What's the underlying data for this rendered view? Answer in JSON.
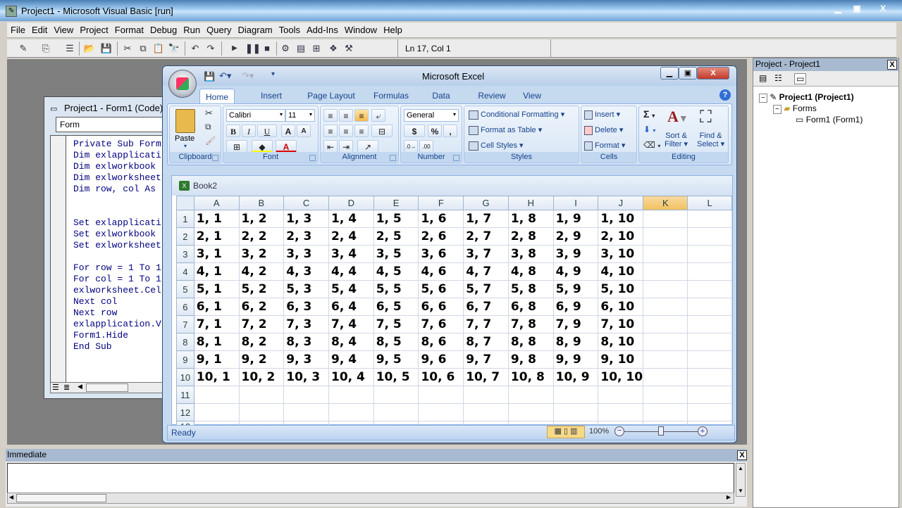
{
  "vb": {
    "title": "Project1 - Microsoft Visual Basic [run]",
    "menu": [
      "File",
      "Edit",
      "View",
      "Project",
      "Format",
      "Debug",
      "Run",
      "Query",
      "Diagram",
      "Tools",
      "Add-Ins",
      "Window",
      "Help"
    ],
    "status_position": "Ln 17, Col 1",
    "window_controls": {
      "minimize": "‒",
      "restore": "▫",
      "close": "X"
    }
  },
  "code_window": {
    "title": "Project1 - Form1 (Code)",
    "object_combo": "Form",
    "lines": [
      "Private Sub Form",
      "Dim exlapplicati",
      "Dim exlworkbook",
      "Dim exlworksheet",
      "Dim row, col As",
      "",
      "",
      "Set exlapplicati",
      "Set exlworkbook",
      "Set exlworksheet",
      "",
      "For row = 1 To 1",
      "For col = 1 To 1",
      "exlworksheet.Cel",
      "Next col",
      "Next row",
      "exlapplication.V",
      "Form1.Hide",
      "End Sub"
    ]
  },
  "excel": {
    "title": "Microsoft Excel",
    "tabs": [
      "Home",
      "Insert",
      "Page Layout",
      "Formulas",
      "Data",
      "Review",
      "View"
    ],
    "active_tab": "Home",
    "ribbon": {
      "clipboard": {
        "label": "Clipboard",
        "paste": "Paste"
      },
      "font": {
        "label": "Font",
        "name": "Calibri",
        "size": "11",
        "bold": "B",
        "italic": "I",
        "underline": "U"
      },
      "alignment": {
        "label": "Alignment"
      },
      "number": {
        "label": "Number",
        "format": "General",
        "currency": "$",
        "percent": "%",
        "comma": ","
      },
      "styles": {
        "label": "Styles",
        "conditional": "Conditional Formatting",
        "format_table": "Format as Table",
        "cell_styles": "Cell Styles"
      },
      "cells": {
        "label": "Cells",
        "insert": "Insert",
        "delete": "Delete",
        "format": "Format"
      },
      "editing": {
        "label": "Editing",
        "sum": "Σ",
        "sort1": "Sort &",
        "sort2": "Filter",
        "find1": "Find &",
        "find2": "Select"
      }
    },
    "workbook": {
      "title": "Book2",
      "columns": [
        "A",
        "B",
        "C",
        "D",
        "E",
        "F",
        "G",
        "H",
        "I",
        "J",
        "K",
        "L"
      ],
      "selected_column": "K",
      "rows": [
        [
          "1, 1",
          "1, 2",
          "1, 3",
          "1, 4",
          "1, 5",
          "1, 6",
          "1, 7",
          "1, 8",
          "1, 9",
          "1, 10",
          "",
          ""
        ],
        [
          "2, 1",
          "2, 2",
          "2, 3",
          "2, 4",
          "2, 5",
          "2, 6",
          "2, 7",
          "2, 8",
          "2, 9",
          "2, 10",
          "",
          ""
        ],
        [
          "3, 1",
          "3, 2",
          "3, 3",
          "3, 4",
          "3, 5",
          "3, 6",
          "3, 7",
          "3, 8",
          "3, 9",
          "3, 10",
          "",
          ""
        ],
        [
          "4, 1",
          "4, 2",
          "4, 3",
          "4, 4",
          "4, 5",
          "4, 6",
          "4, 7",
          "4, 8",
          "4, 9",
          "4, 10",
          "",
          ""
        ],
        [
          "5, 1",
          "5, 2",
          "5, 3",
          "5, 4",
          "5, 5",
          "5, 6",
          "5, 7",
          "5, 8",
          "5, 9",
          "5, 10",
          "",
          ""
        ],
        [
          "6, 1",
          "6, 2",
          "6, 3",
          "6, 4",
          "6, 5",
          "6, 6",
          "6, 7",
          "6, 8",
          "6, 9",
          "6, 10",
          "",
          ""
        ],
        [
          "7, 1",
          "7, 2",
          "7, 3",
          "7, 4",
          "7, 5",
          "7, 6",
          "7, 7",
          "7, 8",
          "7, 9",
          "7, 10",
          "",
          ""
        ],
        [
          "8, 1",
          "8, 2",
          "8, 3",
          "8, 4",
          "8, 5",
          "8, 6",
          "8, 7",
          "8, 8",
          "8, 9",
          "8, 10",
          "",
          ""
        ],
        [
          "9, 1",
          "9, 2",
          "9, 3",
          "9, 4",
          "9, 5",
          "9, 6",
          "9, 7",
          "9, 8",
          "9, 9",
          "9, 10",
          "",
          ""
        ],
        [
          "10, 1",
          "10, 2",
          "10, 3",
          "10, 4",
          "10, 5",
          "10, 6",
          "10, 7",
          "10, 8",
          "10, 9",
          "10, 10",
          "",
          ""
        ],
        [
          "",
          "",
          "",
          "",
          "",
          "",
          "",
          "",
          "",
          "",
          "",
          ""
        ],
        [
          "",
          "",
          "",
          "",
          "",
          "",
          "",
          "",
          "",
          "",
          "",
          ""
        ],
        [
          "",
          "",
          "",
          "",
          "",
          "",
          "",
          "",
          "",
          "",
          "",
          ""
        ]
      ]
    },
    "status": "Ready",
    "zoom": "100%"
  },
  "project": {
    "title": "Project - Project1",
    "root": "Project1 (Project1)",
    "folder": "Forms",
    "form": "Form1 (Form1)"
  },
  "immediate": {
    "title": "Immediate",
    "content": ""
  }
}
